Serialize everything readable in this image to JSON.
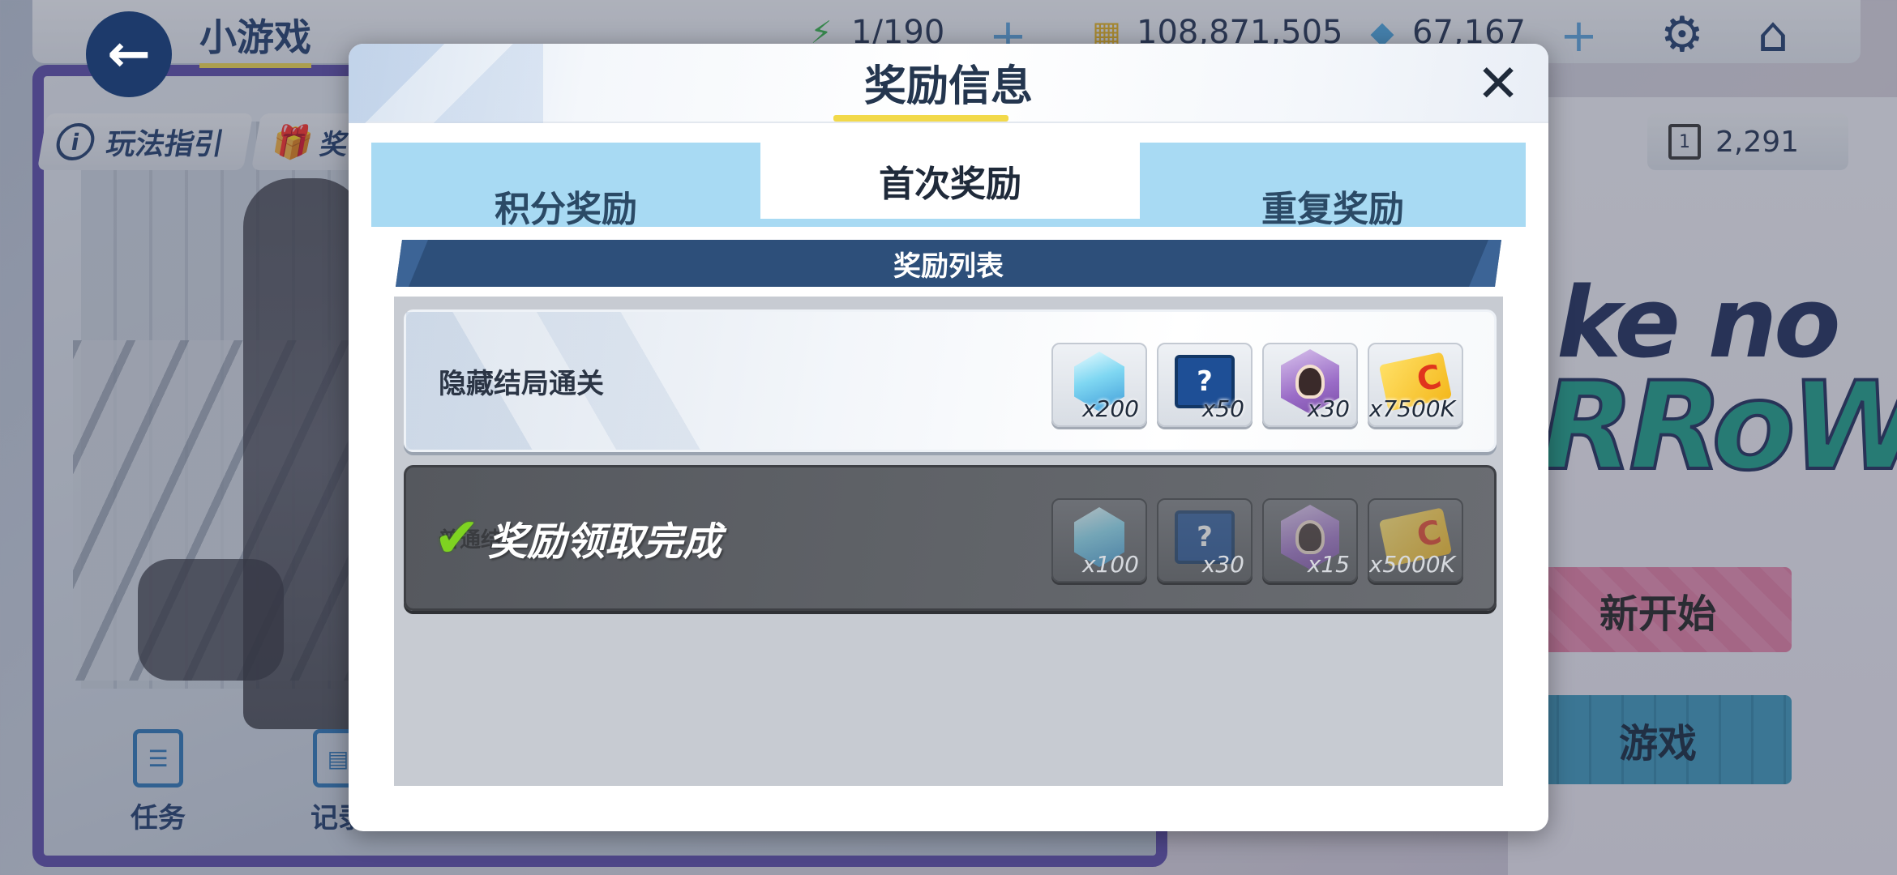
{
  "topbar": {
    "title": "小游戏",
    "stamina": "1/190",
    "coins": "108,871,505",
    "gems": "67,167",
    "tickets": "2,291"
  },
  "side": {
    "guide_label": "玩法指引",
    "gift_label_partial": "奖",
    "mission_label": "任务",
    "record_label_partial": "记录"
  },
  "background": {
    "logo_line1": "ke no",
    "logo_line2": "RRoW",
    "restart_partial": "新开始",
    "locked_game_partial": "游戏"
  },
  "modal": {
    "title": "奖励信息",
    "tabs": [
      {
        "label": "积分奖励",
        "active": false
      },
      {
        "label": "首次奖励",
        "active": true
      },
      {
        "label": "重复奖励",
        "active": false
      }
    ],
    "list_header": "奖励列表",
    "rows": [
      {
        "label": "隐藏结局通关",
        "claimed": false,
        "items": [
          {
            "icon": "crystal-icon",
            "qty": "x200"
          },
          {
            "icon": "mystery-chest-icon",
            "qty": "x50"
          },
          {
            "icon": "character-medal-icon",
            "qty": "x30"
          },
          {
            "icon": "coin-card-icon",
            "qty": "x7500K"
          }
        ]
      },
      {
        "label_partial": "普通结",
        "claimed": true,
        "claimed_text": "奖励领取完成",
        "items": [
          {
            "icon": "crystal-icon",
            "qty": "x100"
          },
          {
            "icon": "mystery-chest-icon",
            "qty": "x30"
          },
          {
            "icon": "character-medal-icon",
            "qty": "x15"
          },
          {
            "icon": "coin-card-icon",
            "qty": "x5000K"
          }
        ]
      }
    ]
  },
  "colors": {
    "navy": "#1d3a6b",
    "tab_bar": "#a8daf3",
    "banner": "#2d4f7a",
    "accent_yellow": "#f2d94a",
    "check_green": "#7ed321"
  }
}
